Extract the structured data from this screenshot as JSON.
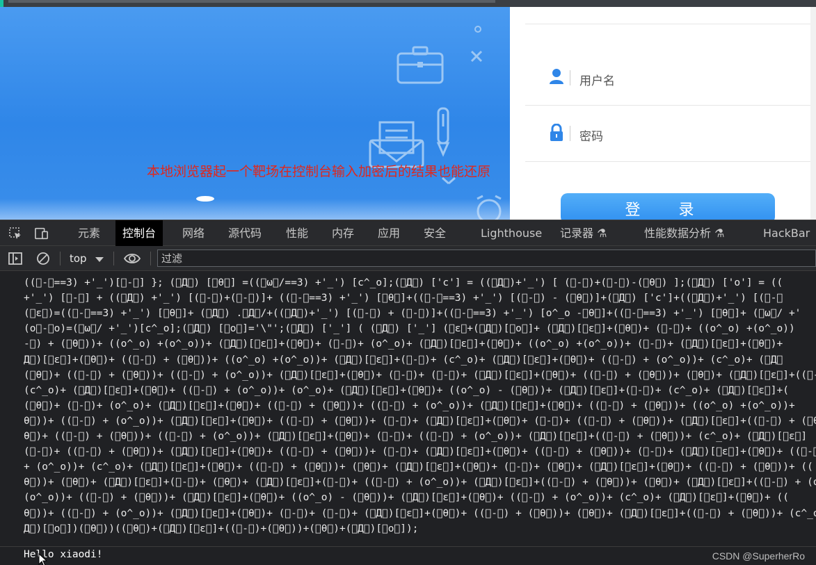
{
  "page": {
    "overlay_note": "本地浏览器起一个靶场在控制台输入加密后的结果也能还原",
    "login": {
      "username_placeholder": "用户名",
      "password_placeholder": "密码",
      "login_button": "登 录"
    }
  },
  "devtools": {
    "tabs": [
      {
        "label": "元素"
      },
      {
        "label": "控制台",
        "active": true
      },
      {
        "label": "网络"
      },
      {
        "label": "源代码"
      },
      {
        "label": "性能"
      },
      {
        "label": "内存"
      },
      {
        "label": "应用"
      },
      {
        "label": "安全"
      },
      {
        "label": "Lighthouse"
      },
      {
        "label": "记录器 ⚗"
      },
      {
        "label": "性能数据分析 ⚗"
      },
      {
        "label": "HackBar"
      }
    ],
    "toolbar": {
      "context": "top",
      "filter_placeholder": "过滤"
    }
  },
  "console": {
    "code_lines": [
      "((゚-゚==3) +'_')[゚-゚] }; (゚Д゚) [゚θ゚] =((゚ω゚/==3) +'_') [c^_o];(゚Д゚) ['c'] = ((゚Д゚)+'_') [ (゚-゚)+(゚-゚)-(゚θ゚) ];(゚Д゚) ['o'] = ((",
      "+'_') [゚-゚] + ((゚Д゚) +'_') [(゚-゚)+(゚-゚)]+ ((゚-゚==3) +'_') [゚θ゚]+((゚-゚==3) +'_') [(゚-゚) - (゚θ゚)]+(゚Д゚) ['c']+((゚Д゚)+'_') [(゚-゚",
      "(゚ε゚)=((゚-゚==3) +'_') [゚θ゚]+ (゚Д゚) .゚Д゚/+((゚Д゚)+'_') [(゚-゚) + (゚-゚)]+((゚-゚==3) +'_') [o^_o -゚θ゚]+((゚-゚==3) +'_') [゚θ゚]+ (゚ω゚/ +'",
      "(o゚-゚o)=(゚ω゚/ +'_')[c^_o];(゚Д゚) [゚o゚]='\\\"';(゚Д゚) ['_'] ( (゚Д゚) ['_'] (゚ε゚+(゚Д゚)[゚o゚]+ (゚Д゚)[゚ε゚]+(゚θ゚)+ (゚-゚)+ ((o^_o) +(o^_o))",
      "-゚) + (゚θ゚))+ ((o^_o) +(o^_o))+ (゚Д゚)[゚ε゚]+(゚θ゚)+ (゚-゚)+ (o^_o)+ (゚Д゚)[゚ε゚]+(゚θ゚)+ ((o^_o) +(o^_o))+ (゚-゚)+ (゚Д゚)[゚ε゚]+(゚θ゚)+",
      "Д゚)[゚ε゚]+(゚θ゚)+ ((゚-゚) + (゚θ゚))+ ((o^_o) +(o^_o))+ (゚Д゚)[゚ε゚]+(゚-゚)+ (c^_o)+ (゚Д゚)[゚ε゚]+(゚θ゚)+ ((゚-゚) + (o^_o))+ (c^_o)+ (゚Д゚",
      "(゚θ゚)+ ((゚-゚) + (゚θ゚))+ ((゚-゚) + (o^_o))+ (゚Д゚)[゚ε゚]+(゚θ゚)+ (゚-゚)+ (゚-゚)+ (゚Д゚)[゚ε゚]+(゚θ゚)+ ((゚-゚) + (゚θ゚))+ (゚θ゚)+ (゚Д゚)[゚ε゚]+((゚-゚",
      "(c^_o)+ (゚Д゚)[゚ε゚]+(゚θ゚)+ ((゚-゚) + (o^_o))+ (o^_o)+ (゚Д゚)[゚ε゚]+(゚θ゚)+ ((o^_o) - (゚θ゚))+ (゚Д゚)[゚ε゚]+(゚-゚)+ (c^_o)+ (゚Д゚)[゚ε゚]+(",
      "(゚θ゚)+ (゚-゚)+ (o^_o)+ (゚Д゚)[゚ε゚]+(゚θ゚)+ ((゚-゚) + (゚θ゚))+ ((゚-゚) + (o^_o))+ (゚Д゚)[゚ε゚]+(゚θ゚)+ ((゚-゚) + (゚θ゚))+ ((o^_o) +(o^_o))+",
      "θ゚))+ ((゚-゚) + (o^_o))+ (゚Д゚)[゚ε゚]+(゚θ゚)+ ((゚-゚) + (゚θ゚))+ (゚-゚)+ (゚Д゚)[゚ε゚]+(゚θ゚)+ (゚-゚)+ ((゚-゚) + (゚θ゚))+ (゚Д゚)[゚ε゚]+((゚-゚) + (゚θ゚",
      "θ゚)+ ((゚-゚) + (゚θ゚))+ ((゚-゚) + (o^_o))+ (゚Д゚)[゚ε゚]+(゚θ゚)+ (゚-゚)+ ((゚-゚) + (o^_o))+ (゚Д゚)[゚ε゚]+((゚-゚) + (゚θ゚))+ (c^_o)+ (゚Д゚)[゚ε゚]",
      "(゚-゚)+ ((゚-゚) + (゚θ゚))+ (゚Д゚)[゚ε゚]+(゚θ゚)+ ((゚-゚) + (゚θ゚))+ (゚-゚)+ (゚Д゚)[゚ε゚]+(゚θ゚)+ ((゚-゚) + (゚θ゚))+ (゚-゚)+ (゚Д゚)[゚ε゚]+(゚θ゚)+ ((゚-゚) +",
      "+ (o^_o))+ (c^_o)+ (゚Д゚)[゚ε゚]+(゚θ゚)+ ((゚-゚) + (゚θ゚))+ (゚θ゚)+ (゚Д゚)[゚ε゚]+(゚θ゚)+ (゚-゚)+ (゚θ゚)+ (゚Д゚)[゚ε゚]+(゚θ゚)+ ((゚-゚) + (゚θ゚))+ ((",
      "θ゚))+ (゚θ゚)+ (゚Д゚)[゚ε゚]+(゚-゚)+ (゚θ゚)+ (゚Д゚)[゚ε゚]+(゚-゚)+ ((゚-゚) + (o^_o))+ (゚Д゚)[゚ε゚]+((゚-゚) + (゚θ゚))+ (゚θ゚)+ (゚Д゚)[゚ε゚]+((゚-゚) + (o^",
      "(o^_o))+ ((゚-゚) + (゚θ゚))+ (゚Д゚)[゚ε゚]+(゚θ゚)+ ((o^_o) - (゚θ゚))+ (゚Д゚)[゚ε゚]+(゚θ゚)+ ((゚-゚) + (o^_o))+ (c^_o)+ (゚Д゚)[゚ε゚]+(゚θ゚)+ ((",
      "θ゚))+ ((゚-゚) + (o^_o))+ (゚Д゚)[゚ε゚]+(゚θ゚)+ (゚-゚)+ (゚-゚)+ (゚Д゚)[゚ε゚]+(゚θ゚)+ ((゚-゚) + (゚θ゚))+ (゚θ゚)+ (゚Д゚)[゚ε゚]+((゚-゚) + (゚θ゚))+ (c^_o",
      "Д゚)[゚o゚])(゚θ゚))((゚θ゚)+(゚Д゚)[゚ε゚]+((゚-゚)+(゚θ゚))+(゚θ゚)+(゚Д゚)[゚o゚]);"
    ],
    "output": "Hello xiaodi!",
    "watermark": "CSDN @SuperherRo"
  }
}
